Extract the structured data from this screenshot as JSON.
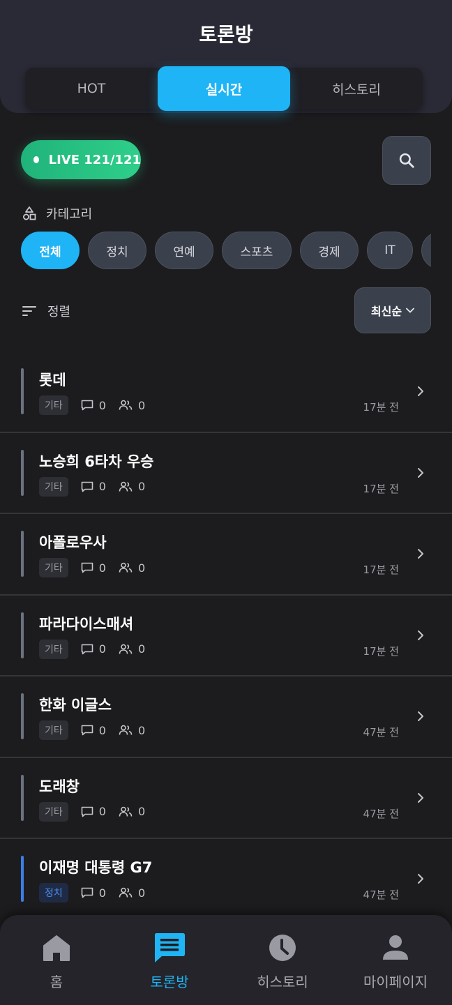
{
  "header": {
    "title": "토론방",
    "tabs": [
      {
        "label": "HOT"
      },
      {
        "label": "실시간"
      },
      {
        "label": "히스토리"
      }
    ]
  },
  "live": {
    "text": "LIVE 121/121"
  },
  "category": {
    "label": "카테고리",
    "chips": [
      {
        "label": "전체"
      },
      {
        "label": "정치"
      },
      {
        "label": "연예"
      },
      {
        "label": "스포츠"
      },
      {
        "label": "경제"
      },
      {
        "label": "IT"
      },
      {
        "label": ""
      }
    ]
  },
  "sort": {
    "label": "정렬",
    "selected": "최신순"
  },
  "rooms": [
    {
      "title": "롯데",
      "tag": "기타",
      "comments": "0",
      "participants": "0",
      "time": "17분 전"
    },
    {
      "title": "노승희 6타차 우승",
      "tag": "기타",
      "comments": "0",
      "participants": "0",
      "time": "17분 전"
    },
    {
      "title": "아폴로우사",
      "tag": "기타",
      "comments": "0",
      "participants": "0",
      "time": "17분 전"
    },
    {
      "title": "파라다이스매셔",
      "tag": "기타",
      "comments": "0",
      "participants": "0",
      "time": "17분 전"
    },
    {
      "title": "한화 이글스",
      "tag": "기타",
      "comments": "0",
      "participants": "0",
      "time": "47분 전"
    },
    {
      "title": "도래창",
      "tag": "기타",
      "comments": "0",
      "participants": "0",
      "time": "47분 전"
    },
    {
      "title": "이재명 대통령 G7",
      "tag": "정치",
      "comments": "0",
      "participants": "0",
      "time": "47분 전"
    }
  ],
  "nav": [
    {
      "label": "홈",
      "icon": "home-icon"
    },
    {
      "label": "토론방",
      "icon": "chat-icon"
    },
    {
      "label": "히스토리",
      "icon": "clock-icon"
    },
    {
      "label": "마이페이지",
      "icon": "person-icon"
    }
  ],
  "colors": {
    "accent": "#1eb4f5",
    "live": "#2fcf8a",
    "politics": "#3b7fe6"
  }
}
